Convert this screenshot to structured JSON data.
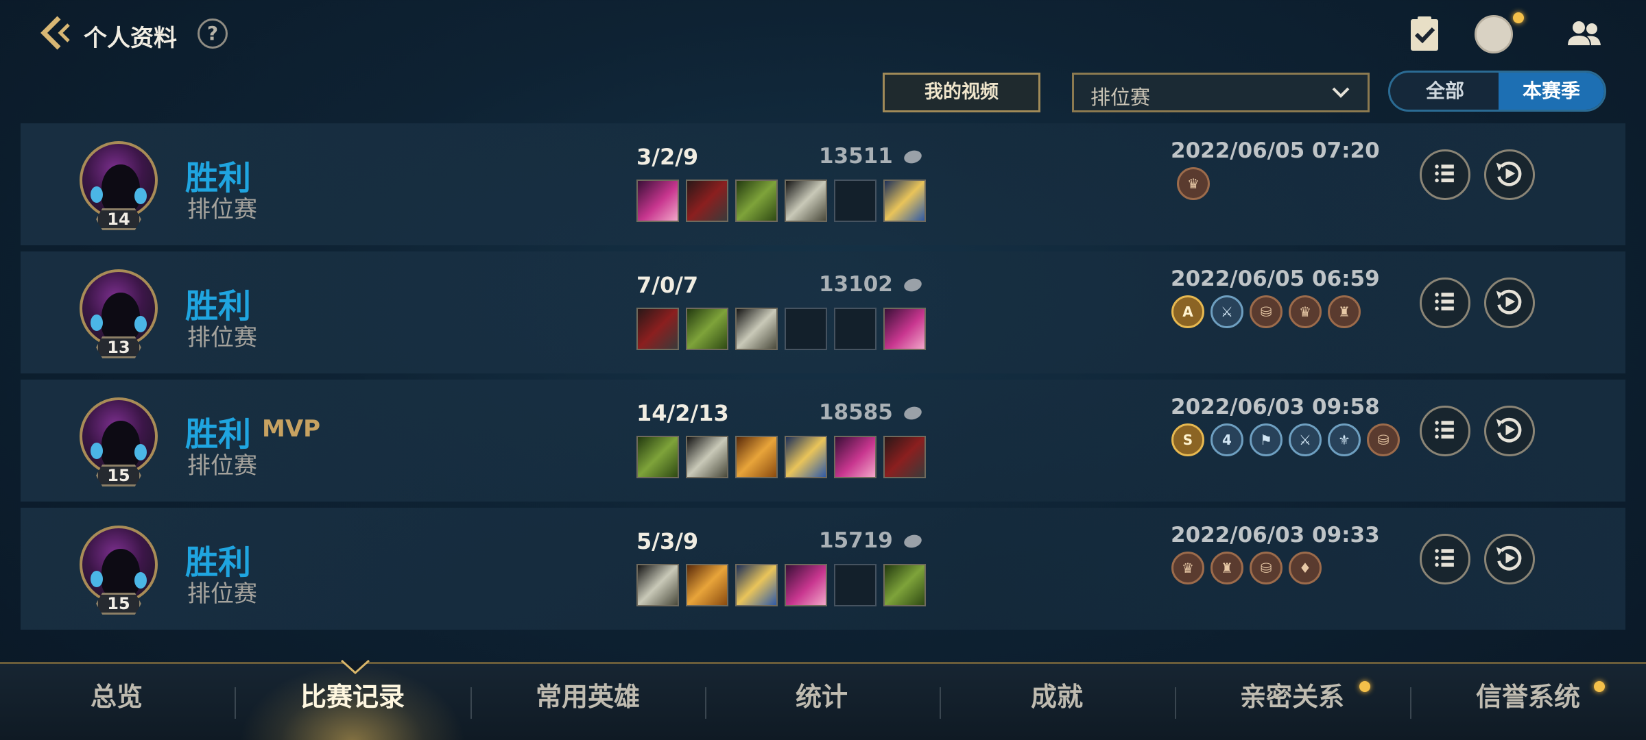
{
  "header": {
    "title": "个人资料",
    "help_label": "?"
  },
  "filters": {
    "videos_label": "我的视频",
    "mode_selected": "排位赛",
    "season_options": [
      "全部",
      "本赛季"
    ],
    "season_selected": "本赛季"
  },
  "matches": [
    {
      "level": "14",
      "result": "胜利",
      "mvp": "",
      "mode": "排位赛",
      "kda": "3/2/9",
      "gold": "13511",
      "time": "2022/06/05 07:20",
      "items": [
        "item",
        "item",
        "item",
        "item",
        "empty",
        "item"
      ],
      "badges": [
        {
          "type": "bronze",
          "symbol": "♛"
        }
      ]
    },
    {
      "level": "13",
      "result": "胜利",
      "mvp": "",
      "mode": "排位赛",
      "kda": "7/0/7",
      "gold": "13102",
      "time": "2022/06/05 06:59",
      "items": [
        "item",
        "item",
        "item",
        "empty",
        "empty",
        "item"
      ],
      "badges": [
        {
          "type": "gold",
          "symbol": "A"
        },
        {
          "type": "blue",
          "symbol": "⚔"
        },
        {
          "type": "bronze",
          "symbol": "⛁"
        },
        {
          "type": "bronze",
          "symbol": "♛"
        },
        {
          "type": "bronze",
          "symbol": "♜"
        }
      ]
    },
    {
      "level": "15",
      "result": "胜利",
      "mvp": "MVP",
      "mode": "排位赛",
      "kda": "14/2/13",
      "gold": "18585",
      "time": "2022/06/03 09:58",
      "items": [
        "item",
        "item",
        "item",
        "item",
        "item",
        "item"
      ],
      "badges": [
        {
          "type": "gold",
          "symbol": "S"
        },
        {
          "type": "blue",
          "symbol": "4"
        },
        {
          "type": "blue",
          "symbol": "⚑"
        },
        {
          "type": "blue",
          "symbol": "⚔"
        },
        {
          "type": "blue",
          "symbol": "⚜"
        },
        {
          "type": "bronze",
          "symbol": "⛁"
        }
      ]
    },
    {
      "level": "15",
      "result": "胜利",
      "mvp": "",
      "mode": "排位赛",
      "kda": "5/3/9",
      "gold": "15719",
      "time": "2022/06/03 09:33",
      "items": [
        "item",
        "item",
        "item",
        "item",
        "empty",
        "item"
      ],
      "badges": [
        {
          "type": "bronze",
          "symbol": "♛"
        },
        {
          "type": "bronze",
          "symbol": "♜"
        },
        {
          "type": "bronze",
          "symbol": "⛁"
        },
        {
          "type": "bronze",
          "symbol": "♦"
        }
      ]
    }
  ],
  "nav": {
    "tabs": [
      "总览",
      "比赛记录",
      "常用英雄",
      "统计",
      "成就",
      "亲密关系",
      "信誉系统"
    ],
    "active_index": 1
  },
  "colors": {
    "win": "#1fa5e0",
    "accent_gold": "#c7a261",
    "notification_dot": "#f4c04a"
  }
}
